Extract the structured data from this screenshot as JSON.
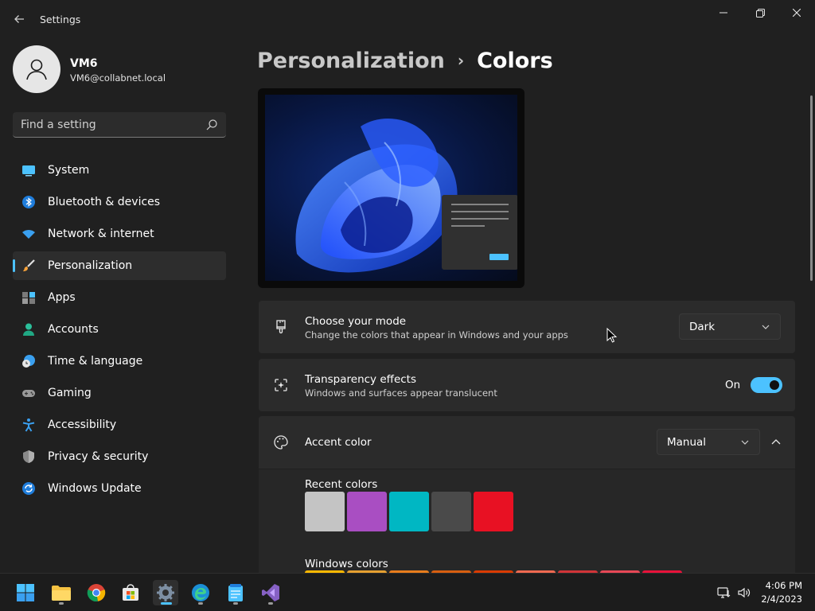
{
  "window": {
    "title": "Settings"
  },
  "profile": {
    "name": "VM6",
    "email": "VM6@collabnet.local"
  },
  "search": {
    "placeholder": "Find a setting"
  },
  "sidebar": {
    "items": [
      {
        "label": "System",
        "icon": "system-icon"
      },
      {
        "label": "Bluetooth & devices",
        "icon": "bluetooth-icon"
      },
      {
        "label": "Network & internet",
        "icon": "wifi-icon"
      },
      {
        "label": "Personalization",
        "icon": "brush-icon",
        "active": true
      },
      {
        "label": "Apps",
        "icon": "apps-icon"
      },
      {
        "label": "Accounts",
        "icon": "accounts-icon"
      },
      {
        "label": "Time & language",
        "icon": "clock-globe-icon"
      },
      {
        "label": "Gaming",
        "icon": "gamepad-icon"
      },
      {
        "label": "Accessibility",
        "icon": "accessibility-icon"
      },
      {
        "label": "Privacy & security",
        "icon": "shield-icon"
      },
      {
        "label": "Windows Update",
        "icon": "update-icon"
      }
    ]
  },
  "breadcrumb": {
    "parent": "Personalization",
    "current": "Colors"
  },
  "mode_card": {
    "title": "Choose your mode",
    "subtitle": "Change the colors that appear in Windows and your apps",
    "value": "Dark"
  },
  "transparency_card": {
    "title": "Transparency effects",
    "subtitle": "Windows and surfaces appear translucent",
    "state_label": "On",
    "enabled": true
  },
  "accent_card": {
    "title": "Accent color",
    "value": "Manual",
    "recent_label": "Recent colors",
    "recent_colors": [
      "#c4c4c4",
      "#a94ec2",
      "#00b7c3",
      "#4a4a4a",
      "#e81123"
    ],
    "windows_label": "Windows colors",
    "windows_colors": [
      "#ffb900",
      "#e6a030",
      "#e87d1c",
      "#d85f10",
      "#da3b01",
      "#ef6950",
      "#d13438",
      "#e74856",
      "#e8123a"
    ]
  },
  "colors": {
    "accent": "#4cc2ff",
    "background": "#202020",
    "card": "#2b2b2b"
  },
  "taskbar": {
    "apps": [
      "start-icon",
      "file-explorer-icon",
      "chrome-icon",
      "store-icon",
      "settings-icon",
      "edge-icon",
      "notepad-icon",
      "visual-studio-icon"
    ],
    "time": "4:06 PM",
    "date": "2/4/2023"
  }
}
